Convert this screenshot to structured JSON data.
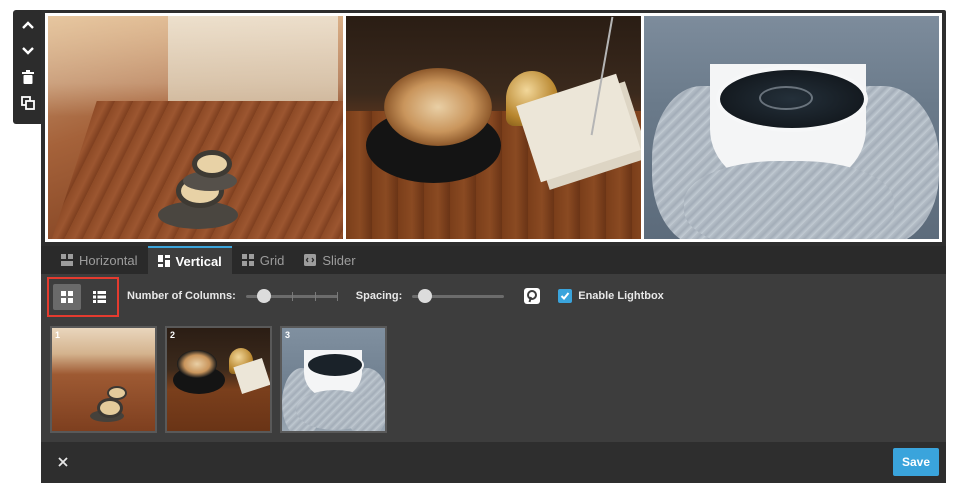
{
  "tabs": [
    {
      "label": "Horizontal",
      "icon": "horizontal-layout-icon",
      "active": false
    },
    {
      "label": "Vertical",
      "icon": "vertical-layout-icon",
      "active": true
    },
    {
      "label": "Grid",
      "icon": "grid-layout-icon",
      "active": false
    },
    {
      "label": "Slider",
      "icon": "slider-layout-icon",
      "active": false
    }
  ],
  "settings": {
    "columns_label": "Number of Columns:",
    "columns_value": 2,
    "columns_max": 6,
    "spacing_label": "Spacing:",
    "spacing_value_fraction": 0.14,
    "lightbox_label": "Enable Lightbox",
    "lightbox_checked": true,
    "layout_options": [
      "grid-view-icon",
      "list-view-icon"
    ],
    "selected_layout": "grid-view-icon"
  },
  "thumbnails": [
    {
      "number": "1",
      "subject": "cafe table"
    },
    {
      "number": "2",
      "subject": "latte"
    },
    {
      "number": "3",
      "subject": "mug in mittens"
    }
  ],
  "footer": {
    "save_label": "Save"
  },
  "colors": {
    "accent": "#3aa4dc",
    "highlight": "#e43b2f",
    "panel_bg": "#2e2e2e",
    "settings_bg": "#3d3d3d"
  }
}
